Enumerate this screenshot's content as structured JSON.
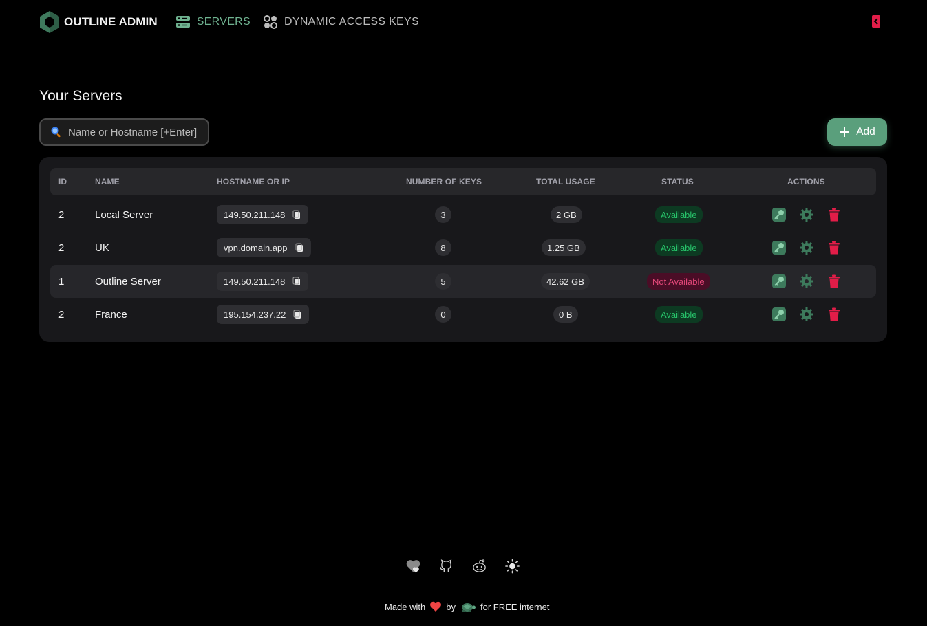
{
  "header": {
    "brand": "OUTLINE ADMIN",
    "nav": [
      {
        "label": "SERVERS",
        "active": true,
        "icon": "servers-icon"
      },
      {
        "label": "DYNAMIC ACCESS KEYS",
        "active": false,
        "icon": "dynamic-keys-icon"
      }
    ],
    "logout_icon": "logout-icon"
  },
  "page_title": "Your Servers",
  "search": {
    "placeholder": "Name or Hostname [+Enter]",
    "value": ""
  },
  "add_button": {
    "label": "Add"
  },
  "table": {
    "columns": [
      "ID",
      "NAME",
      "HOSTNAME OR IP",
      "NUMBER OF KEYS",
      "TOTAL USAGE",
      "STATUS",
      "ACTIONS"
    ],
    "rows": [
      {
        "id": "2",
        "name": "Local Server",
        "host": "149.50.211.148",
        "keys": "3",
        "usage": "2 GB",
        "status": "Available",
        "available": true
      },
      {
        "id": "2",
        "name": "UK",
        "host": "vpn.domain.app",
        "keys": "8",
        "usage": "1.25 GB",
        "status": "Available",
        "available": true
      },
      {
        "id": "1",
        "name": "Outline Server",
        "host": "149.50.211.148",
        "keys": "5",
        "usage": "42.62 GB",
        "status": "Not Available",
        "available": false
      },
      {
        "id": "2",
        "name": "France",
        "host": "195.154.237.22",
        "keys": "0",
        "usage": "0 B",
        "status": "Available",
        "available": true
      }
    ]
  },
  "footer": {
    "icons": [
      "donate-heart-icon",
      "github-icon",
      "reddit-icon",
      "theme-sun-icon"
    ],
    "made_with": "Made with",
    "by": "by",
    "tagline": "for FREE internet"
  },
  "colors": {
    "accent": "#5a9f7c",
    "nav_active": "#6fb290",
    "danger": "#e11d48",
    "available_text": "#27c36a",
    "unavailable_text": "#e5487a",
    "card_bg": "#18181b"
  }
}
